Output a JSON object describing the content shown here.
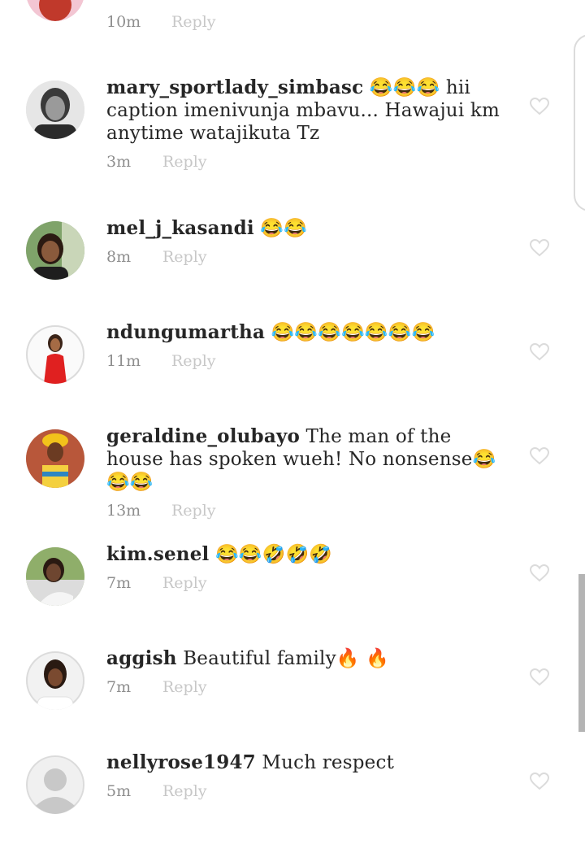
{
  "reply_label": "Reply",
  "top_partial": {
    "time": "10m"
  },
  "comments": [
    {
      "username": "mary_sportlady_simbasc",
      "text": " 😂😂😂 hii caption imenivunja mbavu... Hawajui km anytime watajikuta Tz",
      "time": "3m",
      "avatar": "woman-photo-grayscale"
    },
    {
      "username": "mel_j_kasandi",
      "text": " 😂😂",
      "time": "8m",
      "avatar": "woman-photo-outdoor"
    },
    {
      "username": "ndungumartha",
      "text": " 😂😂😂😂😂😂😂",
      "time": "11m",
      "avatar": "woman-red-dress-photo"
    },
    {
      "username": "geraldine_olubayo",
      "text": " The man of the house has spoken wueh! No nonsense😂😂😂",
      "time": "13m",
      "avatar": "woman-headwrap-photo"
    },
    {
      "username": "kim.senel",
      "text": " 😂😂🤣🤣🤣",
      "time": "7m",
      "avatar": "woman-portrait-photo"
    },
    {
      "username": "aggish",
      "text": " Beautiful family🔥 🔥",
      "time": "7m",
      "avatar": "woman-braids-photo"
    },
    {
      "username": "nellyrose1947",
      "text": " Much respect",
      "time": "5m",
      "avatar": "default-avatar"
    }
  ],
  "colors": {
    "reply": "#c7c7c7",
    "time": "#8e8e8e",
    "heart": "#dbdbdb",
    "scrollbar": "#b4b4b4"
  }
}
